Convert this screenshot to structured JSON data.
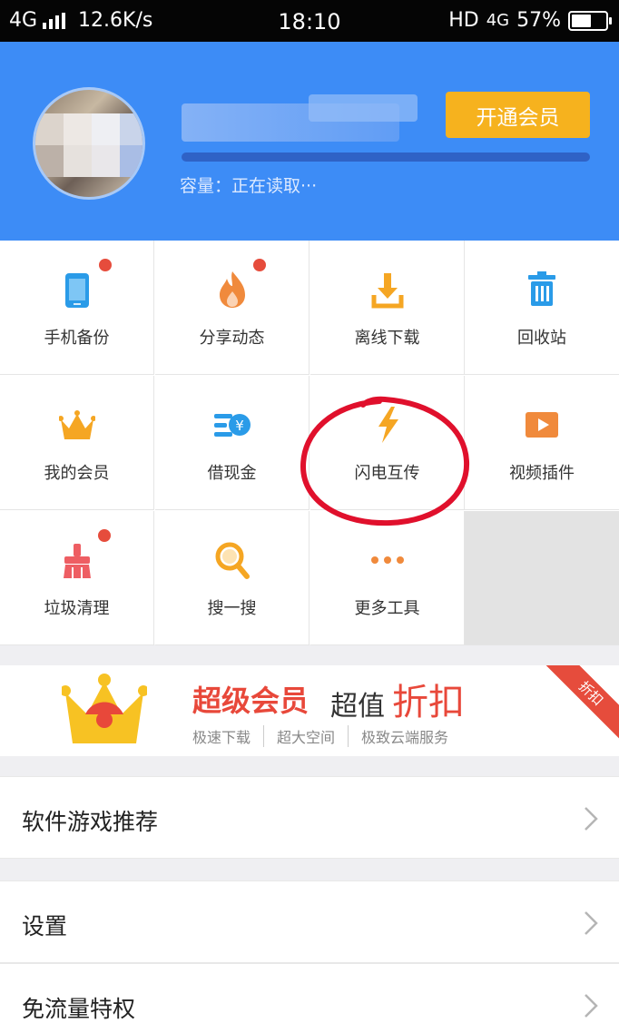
{
  "status_bar": {
    "network": "4G",
    "speed": "12.6K/s",
    "time": "18:10",
    "hd": "HD",
    "network_right": "4G",
    "battery": "57%",
    "battery_level": 0.57
  },
  "header": {
    "capacity_label": "容量：正在读取···",
    "vip_button": "开通会员"
  },
  "tools": [
    {
      "label": "手机备份",
      "icon": "phone-icon",
      "badge": true
    },
    {
      "label": "分享动态",
      "icon": "flame-icon",
      "badge": true
    },
    {
      "label": "离线下载",
      "icon": "download-icon",
      "badge": false
    },
    {
      "label": "回收站",
      "icon": "trash-icon",
      "badge": false
    },
    {
      "label": "我的会员",
      "icon": "crown-icon",
      "badge": false
    },
    {
      "label": "借现金",
      "icon": "cash-icon",
      "badge": false
    },
    {
      "label": "闪电互传",
      "icon": "lightning-icon",
      "badge": false
    },
    {
      "label": "视频插件",
      "icon": "video-icon",
      "badge": false
    },
    {
      "label": "垃圾清理",
      "icon": "broom-icon",
      "badge": true
    },
    {
      "label": "搜一搜",
      "icon": "magnifier-icon",
      "badge": false
    },
    {
      "label": "更多工具",
      "icon": "more-icon",
      "badge": false
    }
  ],
  "banner": {
    "title_bold": "超级会员",
    "title_mid": "超值",
    "title_big": "折扣",
    "features": [
      "极速下载",
      "超大空间",
      "极致云端服务"
    ],
    "ribbon": "折扣"
  },
  "menu": [
    {
      "label": "软件游戏推荐"
    },
    {
      "label": "设置"
    },
    {
      "label": "免流量特权"
    }
  ],
  "colors": {
    "header_bg": "#3d8cf6",
    "vip_button": "#f6b21e",
    "accent_red": "#e8483a",
    "icon_blue": "#2a9be8",
    "icon_orange": "#f08a3c"
  }
}
